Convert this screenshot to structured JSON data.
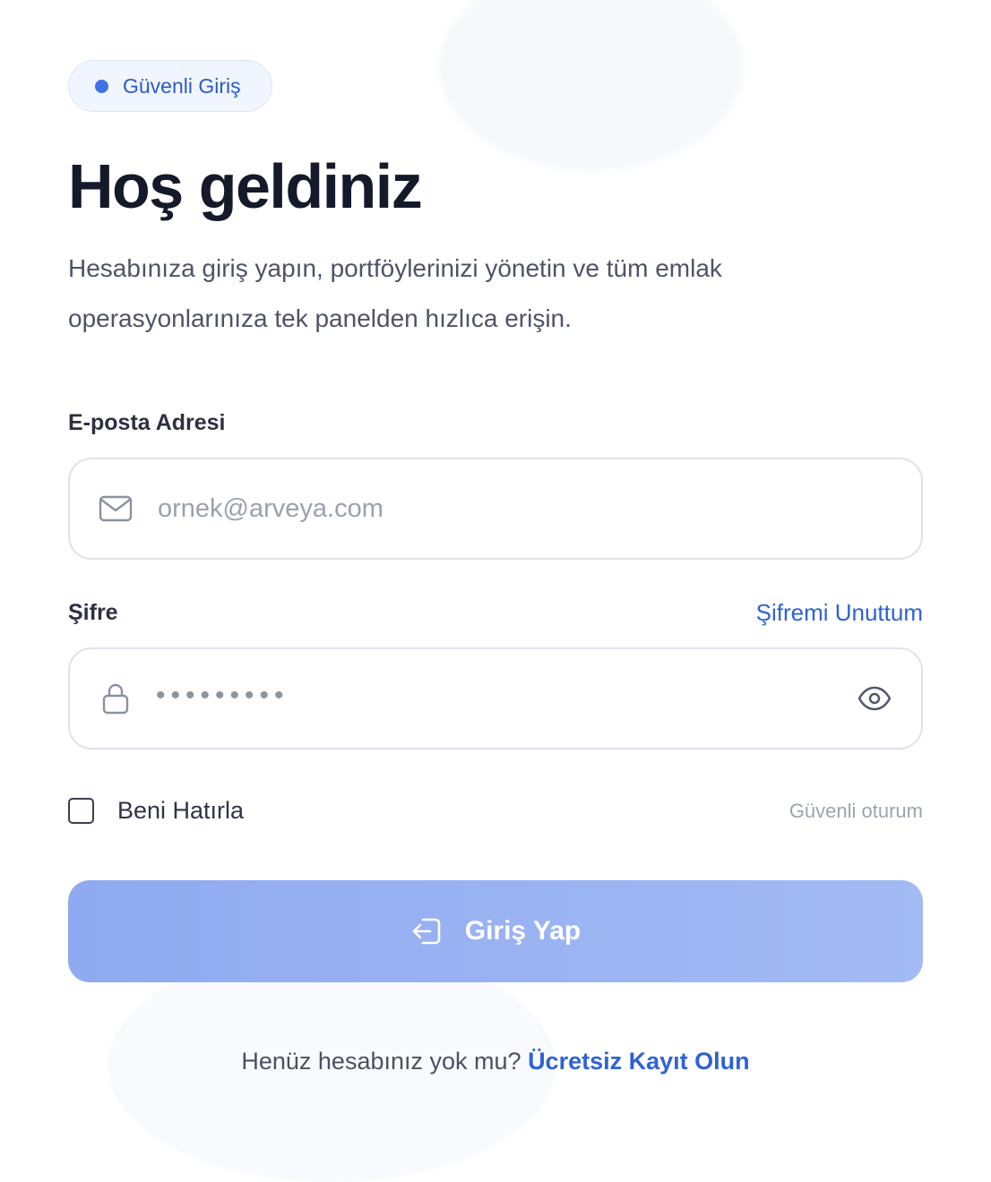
{
  "badge": {
    "label": "Güvenli Giriş"
  },
  "page_title": "Hoş geldiniz",
  "subtitle": "Hesabınıza giriş yapın, portföylerinizi yönetin ve tüm emlak operasyonlarınıza tek panelden hızlıca erişin.",
  "email": {
    "label": "E-posta Adresi",
    "placeholder": "ornek@arveya.com",
    "value": "",
    "icon": "mail-icon"
  },
  "password": {
    "label": "Şifre",
    "forgot_label": "Şifremi Unuttum",
    "masked_value": "•••••••••",
    "icon": "lock-icon",
    "toggle_icon": "eye-icon"
  },
  "remember": {
    "label": "Beni Hatırla",
    "checked": false
  },
  "secure_session_note": "Güvenli oturum",
  "submit": {
    "label": "Giriş Yap",
    "icon": "login-icon"
  },
  "footer": {
    "prompt": "Henüz hesabınız yok mu?",
    "link": "Ücretsiz Kayıt Olun"
  },
  "colors": {
    "accent": "#2f62d6",
    "badge_dot": "#3e73e6",
    "button": "#8faaf0",
    "title": "#141a29"
  }
}
